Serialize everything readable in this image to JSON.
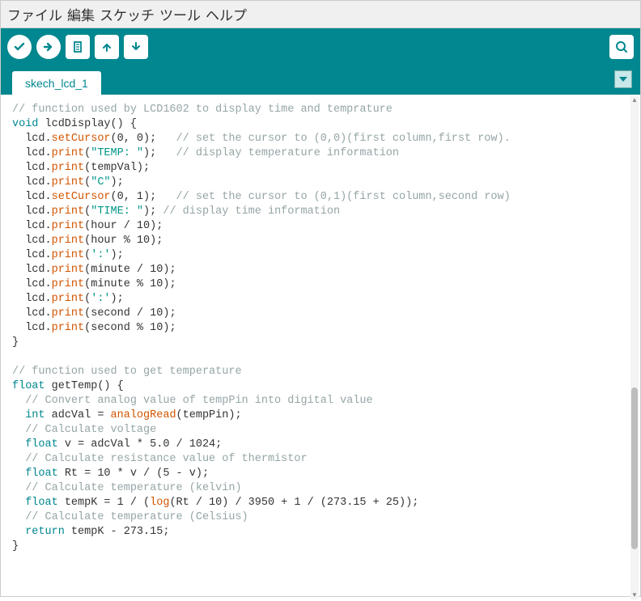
{
  "menu": {
    "file": "ファイル",
    "edit": "編集",
    "sketch": "スケッチ",
    "tools": "ツール",
    "help": "ヘルプ"
  },
  "toolbar": {
    "verify": "verify",
    "upload": "upload",
    "new": "new",
    "open": "open",
    "save": "save",
    "serial": "serial-monitor"
  },
  "tabs": {
    "active": "skech_lcd_1"
  },
  "code": {
    "l1": "// function used by LCD1602 to display time and temprature",
    "l2a": "void",
    "l2b": " lcdDisplay() {",
    "l3a": "  lcd.",
    "l3b": "setCursor",
    "l3c": "(0, 0);   ",
    "l3d": "// set the cursor to (0,0)(first column,first row).",
    "l4a": "  lcd.",
    "l4b": "print",
    "l4c": "(",
    "l4d": "\"TEMP: \"",
    "l4e": ");   ",
    "l4f": "// display temperature information",
    "l5a": "  lcd.",
    "l5b": "print",
    "l5c": "(tempVal);",
    "l6a": "  lcd.",
    "l6b": "print",
    "l6c": "(",
    "l6d": "\"C\"",
    "l6e": ");",
    "l7a": "  lcd.",
    "l7b": "setCursor",
    "l7c": "(0, 1);   ",
    "l7d": "// set the cursor to (0,1)(first column,second row)",
    "l8a": "  lcd.",
    "l8b": "print",
    "l8c": "(",
    "l8d": "\"TIME: \"",
    "l8e": "); ",
    "l8f": "// display time information",
    "l9a": "  lcd.",
    "l9b": "print",
    "l9c": "(hour / 10);",
    "l10a": "  lcd.",
    "l10b": "print",
    "l10c": "(hour % 10);",
    "l11a": "  lcd.",
    "l11b": "print",
    "l11c": "(",
    "l11d": "':'",
    "l11e": ");",
    "l12a": "  lcd.",
    "l12b": "print",
    "l12c": "(minute / 10);",
    "l13a": "  lcd.",
    "l13b": "print",
    "l13c": "(minute % 10);",
    "l14a": "  lcd.",
    "l14b": "print",
    "l14c": "(",
    "l14d": "':'",
    "l14e": ");",
    "l15a": "  lcd.",
    "l15b": "print",
    "l15c": "(second / 10);",
    "l16a": "  lcd.",
    "l16b": "print",
    "l16c": "(second % 10);",
    "l17": "}",
    "l18": "",
    "l19": "// function used to get temperature",
    "l20a": "float",
    "l20b": " getTemp() {",
    "l21": "  // Convert analog value of tempPin into digital value",
    "l22a": "  int",
    "l22b": " adcVal = ",
    "l22c": "analogRead",
    "l22d": "(tempPin);",
    "l23": "  // Calculate voltage",
    "l24a": "  float",
    "l24b": " v = adcVal * 5.0 / 1024;",
    "l25": "  // Calculate resistance value of thermistor",
    "l26a": "  float",
    "l26b": " Rt = 10 * v / (5 - v);",
    "l27": "  // Calculate temperature (kelvin)",
    "l28a": "  float",
    "l28b": " tempK = 1 / (",
    "l28c": "log",
    "l28d": "(Rt / 10) / 3950 + 1 / (273.15 + 25));",
    "l29": "  // Calculate temperature (Celsius)",
    "l30a": "  return",
    "l30b": " tempK - 273.15;",
    "l31": "}"
  }
}
